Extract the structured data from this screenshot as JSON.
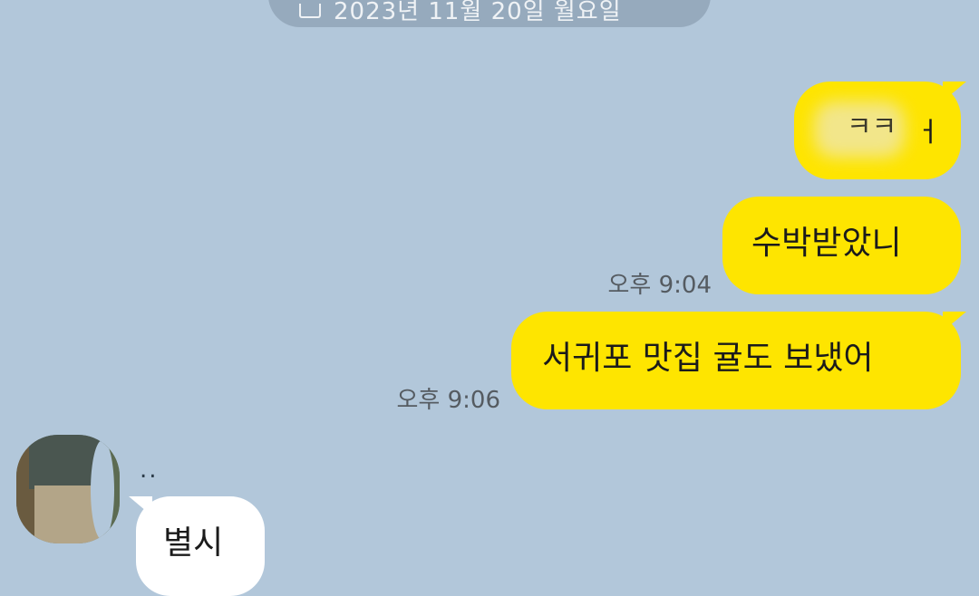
{
  "date_header": {
    "icon": "calendar-icon",
    "text": "2023년 11월 20일 월요일"
  },
  "messages": [
    {
      "side": "sent",
      "text": "ㅋㅋ",
      "blurred": true,
      "trailing": "ㅓ"
    },
    {
      "side": "sent",
      "text": "수박받았니",
      "time": "오후 9:04"
    },
    {
      "side": "sent",
      "text": "서귀포 맛집 귤도 보냈어",
      "time": "오후 9:06"
    },
    {
      "side": "received",
      "sender": "..",
      "text": "별시"
    }
  ],
  "colors": {
    "background": "#b2c7da",
    "sent_bubble": "#fee500",
    "received_bubble": "#ffffff",
    "timestamp": "#555b61"
  }
}
